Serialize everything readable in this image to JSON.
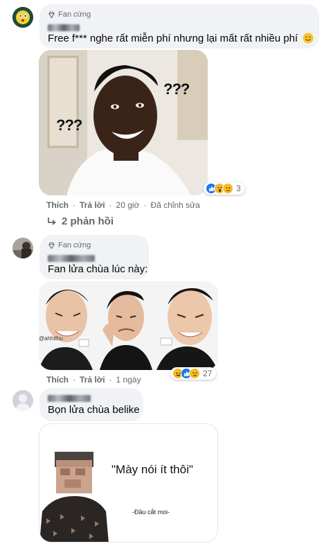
{
  "comments": [
    {
      "badge": "Fan cứng",
      "text": "Free f*** nghe rất miễn phí nhưng lại mất rất nhiều phí",
      "image_labels": [
        "???",
        "???"
      ],
      "actions": {
        "like": "Thích",
        "reply": "Trả lời",
        "time": "20 giờ",
        "edited": "Đã chỉnh sửa"
      },
      "reactions": {
        "icons": [
          "like-icon",
          "wow-icon",
          "sad-icon"
        ],
        "count": "3"
      },
      "replies_link": "2 phản hồi"
    },
    {
      "badge": "Fan cứng",
      "text": "Fan lửa chùa lúc này:",
      "image_labels": [
        "@ahhtthu"
      ],
      "actions": {
        "like": "Thích",
        "reply": "Trả lời",
        "time": "1 ngày"
      },
      "reactions": {
        "icons": [
          "haha-icon",
          "like-icon",
          "sad-icon"
        ],
        "count": "27"
      }
    },
    {
      "text": "Bọn lửa chùa belike",
      "image_labels": [
        "\"Mày nói ít thôi\"",
        "-Đầu cắt moi-"
      ]
    }
  ],
  "colors": {
    "bubble": "#f0f2f5",
    "meta": "#65676b",
    "like": "#1877f2",
    "reaction_yellow": "#f7b928"
  }
}
